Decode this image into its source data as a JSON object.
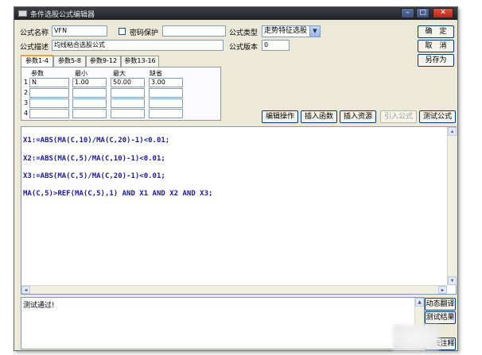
{
  "window": {
    "title": "条件选股公式编辑器",
    "controls": {
      "minimize": "–",
      "maximize": "□",
      "close": "✕"
    }
  },
  "form": {
    "name_label": "公式名称",
    "name_value": "VFN",
    "password_label": "密码保护",
    "password_value": "",
    "type_label": "公式类型",
    "type_value": "走势特征选股",
    "desc_label": "公式描述",
    "desc_value": "均线粘合选股公式",
    "version_label": "公式版本",
    "version_value": "0"
  },
  "buttons": {
    "confirm": "确　定",
    "cancel": "取　消",
    "save_as": "另存为",
    "edit_ops": "编辑操作",
    "insert_func": "插入函数",
    "insert_resource": "插入资源",
    "import_formula": "引入公式",
    "test_formula": "测试公式",
    "dynamic_translate": "动态翻译",
    "test_result": "测试结果",
    "usage_notes": "用法注释"
  },
  "tabs": [
    {
      "label": "参数1-4",
      "active": true
    },
    {
      "label": "参数5-8",
      "active": false
    },
    {
      "label": "参数9-12",
      "active": false
    },
    {
      "label": "参数13-16",
      "active": false
    }
  ],
  "params": {
    "headers": [
      "参数",
      "最小",
      "最大",
      "缺省"
    ],
    "rows": [
      {
        "num": "1",
        "name": "N",
        "min": "1.00",
        "max": "50.00",
        "default": "3.00"
      },
      {
        "num": "2",
        "name": "",
        "min": "",
        "max": "",
        "default": ""
      },
      {
        "num": "3",
        "name": "",
        "min": "",
        "max": "",
        "default": ""
      },
      {
        "num": "4",
        "name": "",
        "min": "",
        "max": "",
        "default": ""
      }
    ]
  },
  "code": [
    "X1:=ABS(MA(C,10)/MA(C,20)-1)<0.01;",
    "X2:=ABS(MA(C,5)/MA(C,10)-1)<0.01;",
    "X3:=ABS(MA(C,5)/MA(C,20)-1)<0.01;",
    "MA(C,5)>REF(MA(C,5),1) AND X1 AND X2 AND X3;"
  ],
  "output": {
    "message": "测试通过!"
  },
  "colors": {
    "code_text": "#1a1a9a",
    "window_bg": "#ece9d8",
    "titlebar": "#2a2e34"
  }
}
